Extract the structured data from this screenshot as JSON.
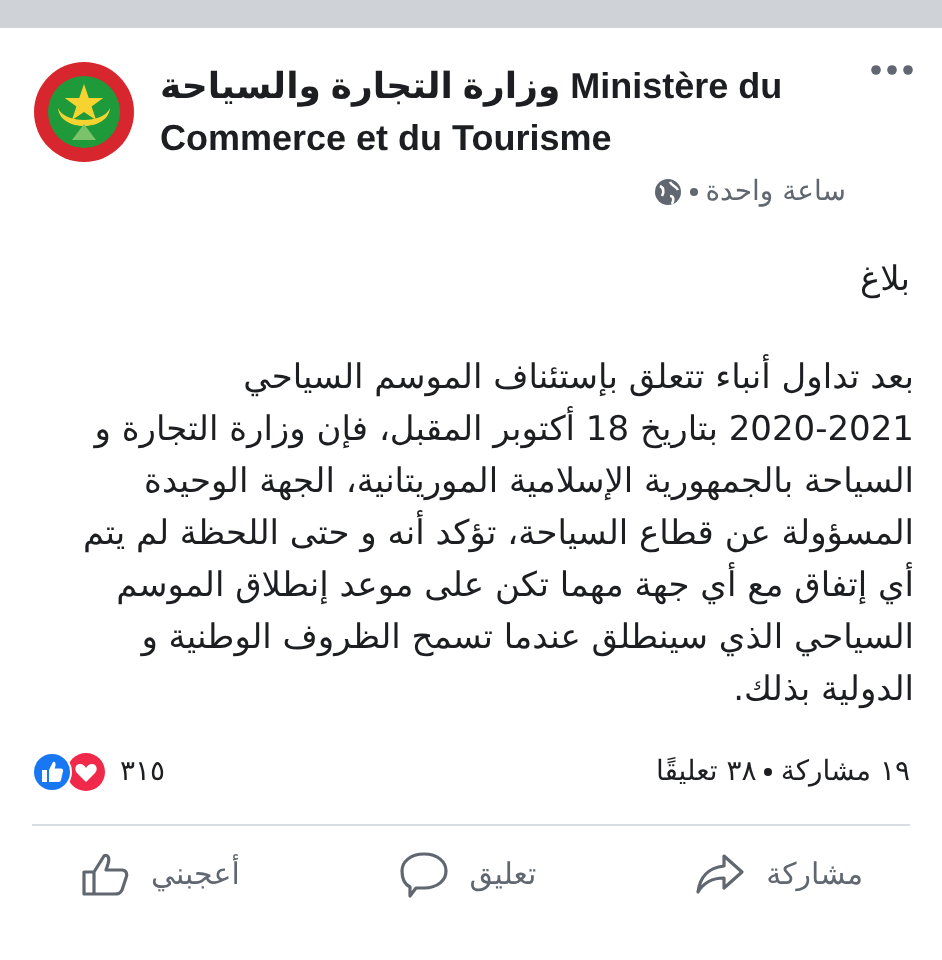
{
  "post": {
    "author": "وزارة التجارة والسياحة  Ministère du Commerce et du Tourisme",
    "time": "ساعة واحدة",
    "title": "بلاغ",
    "body_lines": [
      "بعد تداول أنباء تتعلق بإستئناف الموسم السياحي",
      "2020-2021 بتاريخ 18 أكتوبر المقبل، فإن وزارة التجارة و",
      "السياحة بالجمهورية الإسلامية الموريتانية، الجهة الوحيدة",
      "المسؤولة عن قطاع السياحة، تؤكد أنه و حتى اللحظة لم يتم",
      "أي إتفاق مع أي جهة مهما تكن على موعد إنطلاق الموسم",
      "السياحي الذي سينطلق عندما تسمح الظروف الوطنية و",
      "الدولية بذلك."
    ],
    "shares": "١٩ مشاركة",
    "comments": "٣٨ تعليقًا",
    "reactions": "٣١٥"
  },
  "actions": [
    {
      "kind": "share",
      "label": "مشاركة"
    },
    {
      "kind": "comment",
      "label": "تعليق"
    },
    {
      "kind": "like",
      "label": "أعجبني"
    }
  ]
}
